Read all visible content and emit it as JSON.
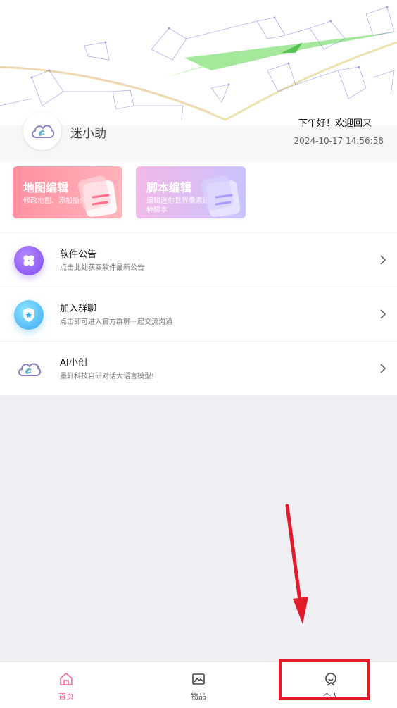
{
  "header": {
    "app_name": "迷小助",
    "greeting": "下午好！欢迎回来",
    "datetime": "2024-10-17 14:56:58",
    "avatar_icon": "cloud-logo-icon"
  },
  "cards": [
    {
      "title": "地图编辑",
      "subtitle": "修改地图、添加插件",
      "icon": "notepad-icon"
    },
    {
      "title": "脚本编辑",
      "subtitle": "编辑迷你世界像素画等各种脚本",
      "icon": "notepad-icon"
    }
  ],
  "list": [
    {
      "title": "软件公告",
      "subtitle": "点击此处获取软件最新公告",
      "icon": "clover-icon"
    },
    {
      "title": "加入群聊",
      "subtitle": "点击即可进入官方群聊一起交流沟通",
      "icon": "shield-icon"
    },
    {
      "title": "AI小创",
      "subtitle": "墨轩科技自研对话大语言模型!",
      "icon": "cloud-logo-icon"
    }
  ],
  "tabs": [
    {
      "label": "首页",
      "icon": "home-icon",
      "active": true
    },
    {
      "label": "物品",
      "icon": "image-icon",
      "active": false
    },
    {
      "label": "个人",
      "icon": "person-icon",
      "active": false
    }
  ],
  "colors": {
    "accent": "#f06a93",
    "annotation": "#e21b2b",
    "map_card": "#ff8fa0",
    "script_card": "#c7c4ff"
  }
}
